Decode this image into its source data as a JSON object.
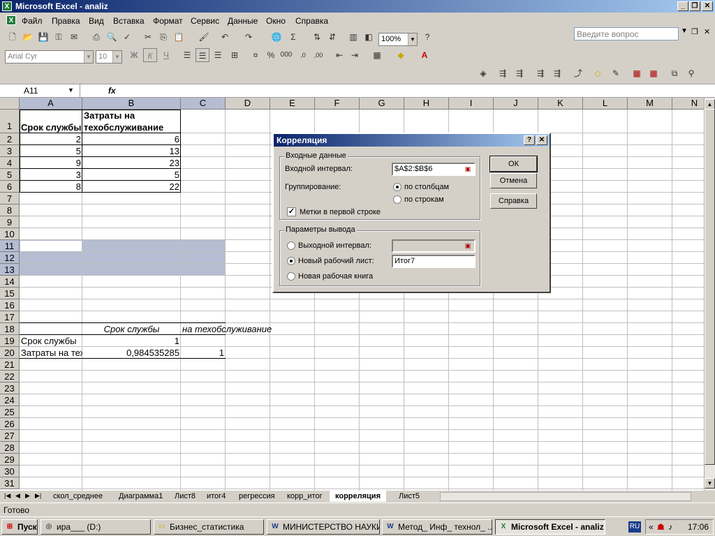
{
  "window": {
    "title": "Microsoft Excel - analiz",
    "app_icon": "excel-icon"
  },
  "menu": [
    "Файл",
    "Правка",
    "Вид",
    "Вставка",
    "Формат",
    "Сервис",
    "Данные",
    "Окно",
    "Справка"
  ],
  "help_box": {
    "placeholder": "Введите вопрос"
  },
  "toolbar": {
    "zoom": "100%",
    "font": "Arial Cyr",
    "font_size": "10",
    "bold": "Ж",
    "italic": "К",
    "underline": "Ч"
  },
  "formula_bar": {
    "name_box": "A11",
    "fx": "fx",
    "value": ""
  },
  "columns": [
    "A",
    "B",
    "C",
    "D",
    "E",
    "F",
    "G",
    "H",
    "I",
    "J",
    "K",
    "L",
    "M",
    "N"
  ],
  "rows": [
    "1",
    "2",
    "3",
    "4",
    "5",
    "6",
    "7",
    "8",
    "9",
    "10",
    "11",
    "12",
    "13",
    "14",
    "15",
    "16",
    "17",
    "18",
    "19",
    "20",
    "21",
    "22",
    "23",
    "24",
    "25",
    "26",
    "27",
    "28",
    "29",
    "30",
    "31"
  ],
  "cells": {
    "a1": "Срок службы",
    "b1_line1": "Затраты на",
    "b1_line2": "техобслуживание",
    "data": [
      [
        "2",
        "6"
      ],
      [
        "5",
        "13"
      ],
      [
        "9",
        "23"
      ],
      [
        "3",
        "5"
      ],
      [
        "8",
        "22"
      ]
    ],
    "b18": "Срок службы",
    "c18": "на техобслуживание",
    "a19": "Срок службы",
    "b19": "1",
    "a20": "Затраты на тех",
    "b20": "0,984535285",
    "c20": "1"
  },
  "sheet_tabs": [
    "скол_среднее",
    "Диаграмма1",
    "Лист8",
    "итог4",
    "регрессия",
    "корр_итог",
    "корреляция",
    "Лист5"
  ],
  "active_tab": "корреляция",
  "status": "Готово",
  "dialog": {
    "title": "Корреляция",
    "input_group": "Входные данные",
    "input_range_label": "Входной интервал:",
    "input_range_value": "$A$2:$B$6",
    "grouping_label": "Группирование:",
    "by_columns": "по столбцам",
    "by_rows": "по строкам",
    "labels_first_row": "Метки в первой строке",
    "output_group": "Параметры вывода",
    "output_range": "Выходной интервал:",
    "new_sheet": "Новый рабочий лист:",
    "new_sheet_value": "Итог7",
    "new_book": "Новая рабочая книга",
    "ok": "ОК",
    "cancel": "Отмена",
    "help": "Справка"
  },
  "taskbar": {
    "start": "Пуск",
    "items": [
      "ира___ (D:)",
      "Бизнес_статистика",
      "МИНИСТЕРСТВО НАУКИ...",
      "Метод_ Инф_ технол_ ...",
      "Microsoft Excel - analiz"
    ],
    "lang": "RU",
    "time": "17:06"
  }
}
